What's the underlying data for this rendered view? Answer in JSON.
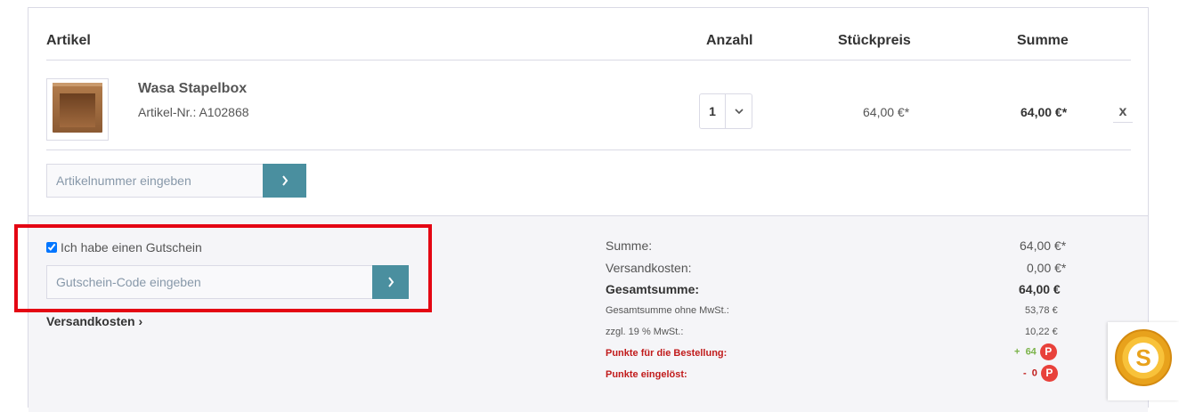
{
  "table": {
    "headers": {
      "article": "Artikel",
      "quantity": "Anzahl",
      "unit_price": "Stückpreis",
      "total": "Summe"
    }
  },
  "item": {
    "name": "Wasa Stapelbox",
    "number": "Artikel-Nr.: A102868",
    "quantity": "1",
    "unit_price": "64,00 €*",
    "total": "64,00 €*",
    "remove": "x"
  },
  "article_input": {
    "placeholder": "Artikelnummer eingeben"
  },
  "voucher": {
    "checkbox_label": "Ich habe einen Gutschein",
    "placeholder": "Gutschein-Code eingeben"
  },
  "shipping_link": "Versandkosten",
  "summary": {
    "subtotal_label": "Summe:",
    "subtotal": "64,00 €*",
    "shipping_label": "Versandkosten:",
    "shipping": "0,00 €*",
    "grand_label": "Gesamtsumme:",
    "grand": "64,00 €",
    "net_label": "Gesamtsumme ohne MwSt.:",
    "net": "53,78 €",
    "tax_label": "zzgl. 19 % MwSt.:",
    "tax": "10,22 €",
    "points_label": "Punkte für die Bestellung:",
    "points_sign": "+",
    "points": "64",
    "redeemed_label": "Punkte eingelöst:",
    "redeemed_sign": "-",
    "redeemed": "0",
    "badge": "P"
  },
  "colors": {
    "accent": "#4a8f9f",
    "highlight": "#e40613",
    "points_green": "#7bb34a",
    "points_red": "#c11b1b"
  }
}
